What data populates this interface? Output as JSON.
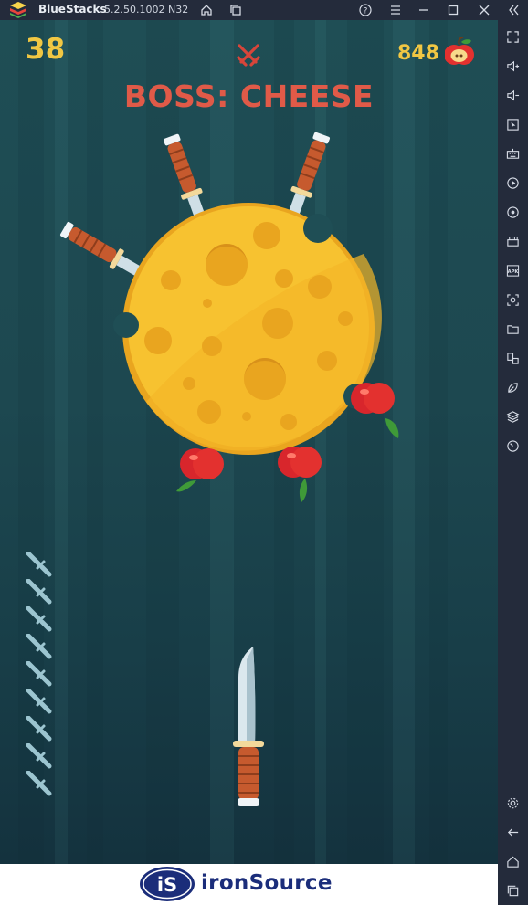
{
  "titlebar": {
    "app_name": "BlueStacks",
    "version": "5.2.50.1002 N32"
  },
  "game": {
    "score": "38",
    "boss_label": "BOSS: CHEESE",
    "apple_count": "848",
    "knives_remaining": 9
  },
  "ad": {
    "brand": "ironSource",
    "logo_text": "iS"
  },
  "colors": {
    "score": "#f1c743",
    "boss_text": "#e05a48",
    "titlebar_bg": "#242b3b",
    "game_bg": "#1f4e55",
    "cheese": "#f7c230",
    "apple": "#d8262c"
  }
}
